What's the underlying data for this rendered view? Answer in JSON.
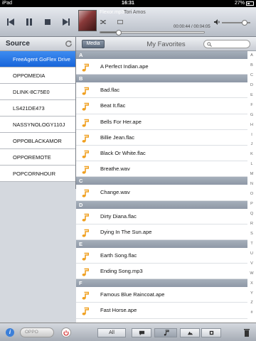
{
  "status_bar": {
    "carrier": "iPad",
    "time": "16:31",
    "battery": "27%"
  },
  "player": {
    "track_file": "Flexor.mp3",
    "artist": "Tori Amos",
    "time": "00:00:44 / 00:04:05",
    "progress": 0.18,
    "volume": 0.82
  },
  "source": {
    "title": "Source",
    "items": [
      "FreeAgent GoFlex Drive",
      "OPPOMEDIA",
      "DLINK-8C75E0",
      "LS421DE473",
      "NASSYNOLOGY110J",
      "OPPOBLACKAMOR",
      "OPPOREMOTE",
      "POPCORNHOUR"
    ],
    "selected": 0,
    "footer_button": "OPPO"
  },
  "main": {
    "media_button": "Media",
    "title": "My Favorites",
    "sections": [
      {
        "letter": "A",
        "songs": [
          "A Perfect Indian.ape"
        ]
      },
      {
        "letter": "B",
        "songs": [
          "Bad.flac",
          "Beat It.flac",
          "Bells For Her.ape",
          "Billie Jean.flac",
          "Black Or White.flac",
          "Breathe.wav"
        ]
      },
      {
        "letter": "C",
        "songs": [
          "Change.wav"
        ]
      },
      {
        "letter": "D",
        "songs": [
          "Dirty Diana.flac",
          "Dying In The Sun.ape"
        ]
      },
      {
        "letter": "E",
        "songs": [
          "Earth Song.flac",
          "Ending Song.mp3"
        ]
      },
      {
        "letter": "F",
        "songs": [
          "Famous Blue Raincoat.ape",
          "Fast Horse.ape"
        ]
      }
    ],
    "index_letters": [
      "A",
      "B",
      "C",
      "D",
      "E",
      "F",
      "G",
      "H",
      "I",
      "J",
      "K",
      "L",
      "M",
      "N",
      "O",
      "P",
      "Q",
      "R",
      "S",
      "T",
      "U",
      "V",
      "W",
      "X",
      "Y",
      "Z",
      "#"
    ],
    "footer_all": "All"
  },
  "colors": {
    "accent": "#1865d9",
    "note": "#f0a020",
    "section": "#9aa3b0"
  }
}
